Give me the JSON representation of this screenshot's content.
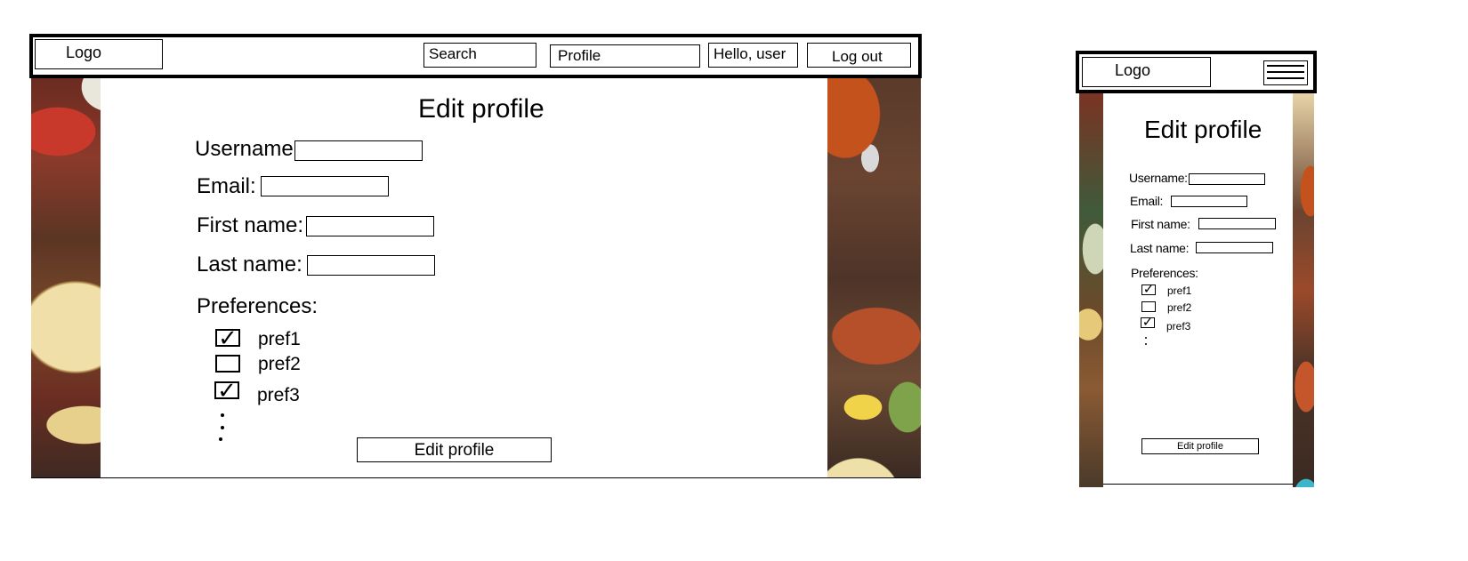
{
  "desktop": {
    "header": {
      "logo": "Logo",
      "search": "Search",
      "profile": "Profile",
      "greeting": "Hello, user",
      "logout": "Log out"
    },
    "form": {
      "title": "Edit profile",
      "username_label": "Username:",
      "username_value": "",
      "email_label": "Email:",
      "email_value": "",
      "first_name_label": "First name:",
      "first_name_value": "",
      "last_name_label": "Last name:",
      "last_name_value": "",
      "preferences_label": "Preferences:",
      "preferences": [
        {
          "label": "pref1",
          "checked": true
        },
        {
          "label": "pref2",
          "checked": false
        },
        {
          "label": "pref3",
          "checked": true
        }
      ],
      "submit": "Edit profile"
    }
  },
  "mobile": {
    "header": {
      "logo": "Logo",
      "menu_icon": "hamburger-menu-icon"
    },
    "form": {
      "title": "Edit profile",
      "username_label": "Username:",
      "email_label": "Email:",
      "first_name_label": "First name:",
      "last_name_label": "Last name:",
      "preferences_label": "Preferences:",
      "preferences": [
        {
          "label": "pref1",
          "checked": true
        },
        {
          "label": "pref2",
          "checked": false
        },
        {
          "label": "pref3",
          "checked": true
        }
      ],
      "submit": "Edit profile"
    }
  },
  "check_glyph": "✓"
}
